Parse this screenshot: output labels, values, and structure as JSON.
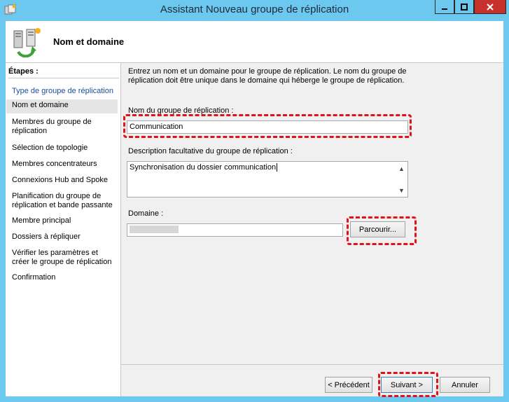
{
  "window": {
    "title": "Assistant Nouveau groupe de réplication"
  },
  "header": {
    "heading": "Nom et domaine"
  },
  "steps": {
    "title": "Étapes :",
    "items": [
      {
        "label": "Type de groupe de réplication"
      },
      {
        "label": "Nom et domaine"
      },
      {
        "label": "Membres du groupe de réplication"
      },
      {
        "label": "Sélection de topologie"
      },
      {
        "label": "Membres concentrateurs"
      },
      {
        "label": "Connexions Hub and Spoke"
      },
      {
        "label": "Planification du groupe de réplication et bande passante"
      },
      {
        "label": "Membre principal"
      },
      {
        "label": "Dossiers à répliquer"
      },
      {
        "label": "Vérifier les paramètres et créer le groupe de réplication"
      },
      {
        "label": "Confirmation"
      }
    ]
  },
  "main": {
    "intro": "Entrez un nom et un domaine pour le groupe de réplication. Le nom du groupe de réplication doit être unique dans le domaine qui héberge le groupe de réplication.",
    "name_label": "Nom du groupe de réplication :",
    "name_value": "Communication",
    "desc_label": "Description facultative du groupe de réplication :",
    "desc_value": "Synchronisation du dossier communication",
    "domain_label": "Domaine :",
    "domain_value": "",
    "browse_label": "Parcourir..."
  },
  "footer": {
    "back_label": "< Précédent",
    "next_label": "Suivant >",
    "cancel_label": "Annuler"
  },
  "colors": {
    "titlebar": "#6cc8ee",
    "close": "#c7312b",
    "highlight": "#e0121a",
    "active_step": "#1a4fa0"
  }
}
